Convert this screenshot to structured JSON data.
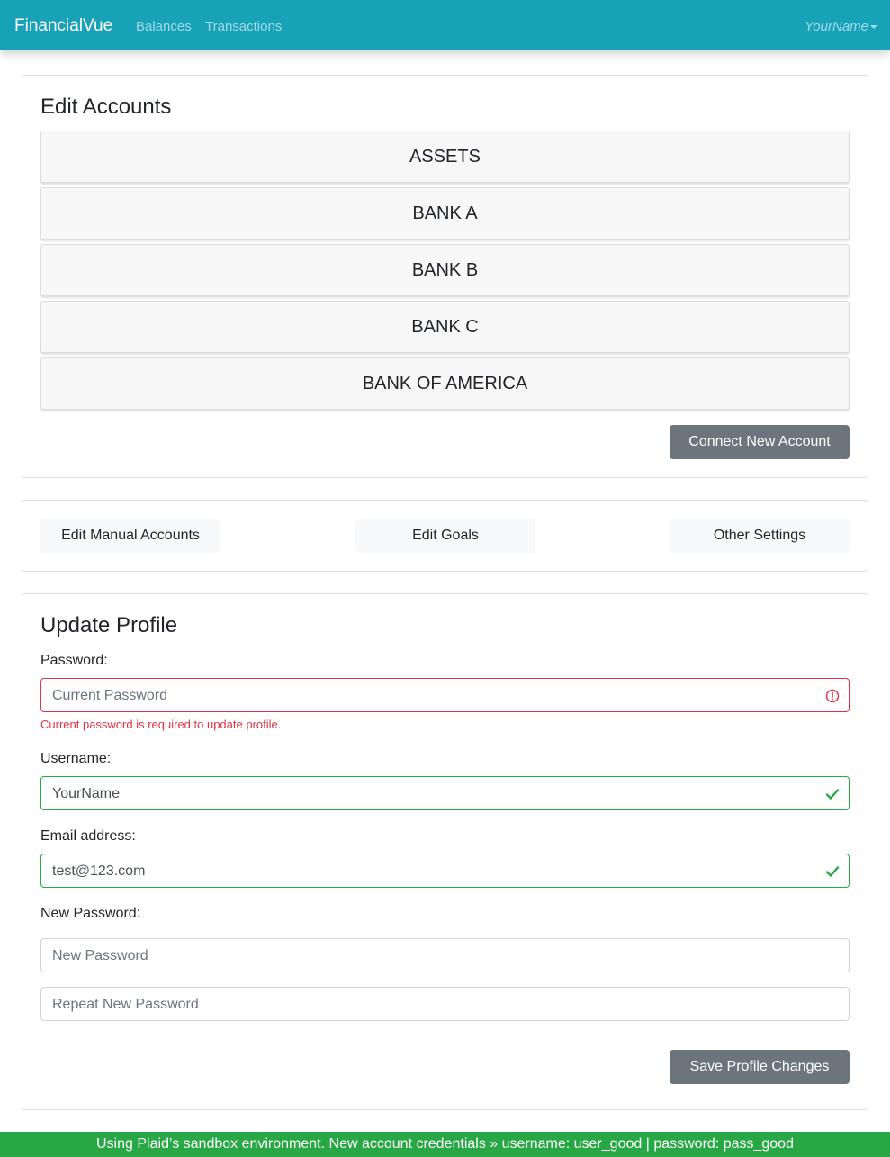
{
  "navbar": {
    "brand": "FinancialVue",
    "links": [
      "Balances",
      "Transactions"
    ],
    "user": "YourName"
  },
  "accounts_card": {
    "title": "Edit Accounts",
    "accounts": [
      "ASSETS",
      "BANK A",
      "BANK B",
      "BANK C",
      "BANK OF AMERICA"
    ],
    "connect_label": "Connect New Account"
  },
  "settings_card": {
    "manual_label": "Edit Manual Accounts",
    "goals_label": "Edit Goals",
    "other_label": "Other Settings"
  },
  "profile_card": {
    "title": "Update Profile",
    "password_label": "Password:",
    "password_placeholder": "Current Password",
    "password_error": "Current password is required to update profile.",
    "username_label": "Username:",
    "username_value": "YourName",
    "email_label": "Email address:",
    "email_value": "test@123.com",
    "new_password_label": "New Password:",
    "new_password_placeholder": "New Password",
    "repeat_password_placeholder": "Repeat New Password",
    "save_label": "Save Profile Changes"
  },
  "footer": {
    "text": "Using Plaid’s sandbox environment. New account credentials » username: user_good | password: pass_good"
  },
  "colors": {
    "navbar": "#17a2b8",
    "footer": "#28a745",
    "secondary_button": "#6c757d",
    "invalid": "#dc3545",
    "valid": "#28a745"
  }
}
